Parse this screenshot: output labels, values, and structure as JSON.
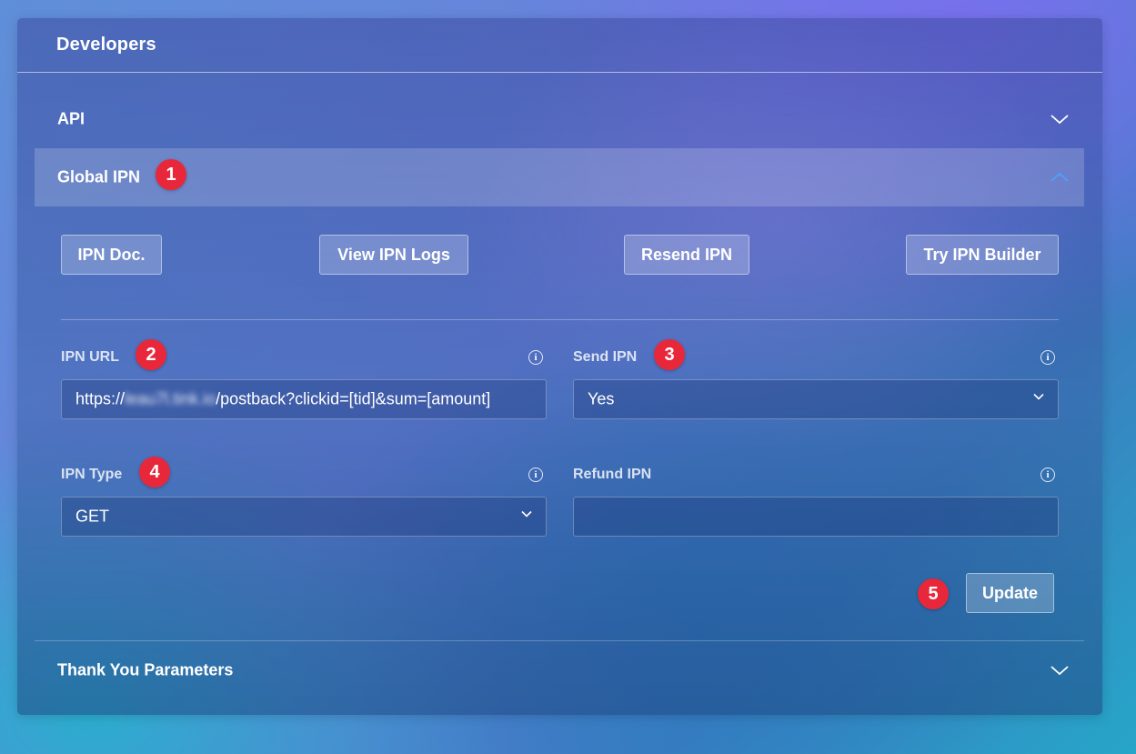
{
  "panel": {
    "title": "Developers"
  },
  "sections": {
    "api": {
      "label": "API"
    },
    "global_ipn": {
      "label": "Global IPN"
    },
    "thank_you": {
      "label": "Thank You Parameters"
    }
  },
  "buttons": {
    "ipn_doc": "IPN Doc.",
    "view_logs": "View IPN Logs",
    "resend": "Resend IPN",
    "builder": "Try IPN Builder",
    "update": "Update"
  },
  "fields": {
    "ipn_url": {
      "label": "IPN URL",
      "value_prefix": "https://",
      "value_blurred": "leau7l.tink.io",
      "value_suffix": "/postback?clickid=[tid]&sum=[amount]"
    },
    "send_ipn": {
      "label": "Send IPN",
      "value": "Yes"
    },
    "ipn_type": {
      "label": "IPN Type",
      "value": "GET"
    },
    "refund_ipn": {
      "label": "Refund IPN",
      "value": ""
    }
  },
  "markers": [
    "1",
    "2",
    "3",
    "4",
    "5"
  ],
  "colors": {
    "marker": "#e8283a",
    "chevron_active": "#4aa3ff"
  },
  "icons": {
    "api_chevron": "chevron-down-icon",
    "global_ipn_chevron": "chevron-up-icon",
    "thank_you_chevron": "chevron-down-icon",
    "info": "info-icon",
    "select_caret": "chevron-down-icon"
  }
}
